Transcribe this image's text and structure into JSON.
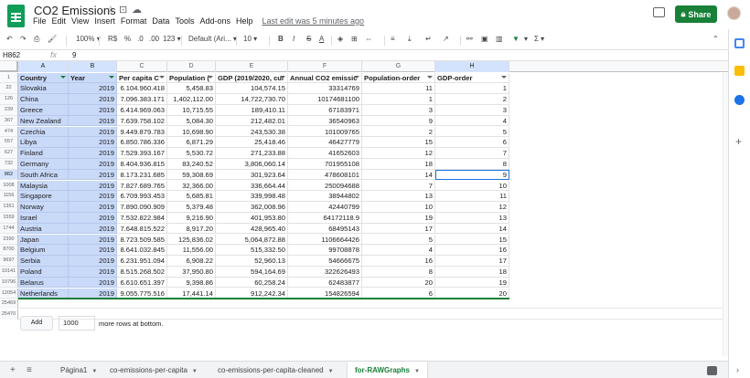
{
  "title_bar": {
    "doc_title": "CO2 Emissions",
    "menu": [
      "File",
      "Edit",
      "View",
      "Insert",
      "Format",
      "Data",
      "Tools",
      "Add-ons",
      "Help"
    ],
    "last_edit": "Last edit was 5 minutes ago",
    "share_label": "Share"
  },
  "toolbar": {
    "zoom": "100%",
    "currency": "R$",
    "percent": "%",
    "decimal_less": ".0",
    "decimal_more": ".00",
    "number_format": "123",
    "font": "Default (Ari...",
    "font_size": "10",
    "bold": "B",
    "italic": "I",
    "strike": "S",
    "text_color": "A",
    "sigma": "Σ"
  },
  "formula_bar": {
    "name_box": "H862",
    "fx": "fx",
    "value": "9"
  },
  "grid": {
    "columns": [
      "A",
      "B",
      "C",
      "D",
      "E",
      "F",
      "G",
      "H"
    ],
    "active_column": "H",
    "headers": [
      "Country",
      "Year",
      "Per capita C",
      "Population (",
      "GDP (2019/2020, cur",
      "Annual CO2 emissic",
      "Population-order",
      "GDP-order"
    ],
    "header_row_num": "1",
    "rows": [
      {
        "n": "22",
        "c": [
          "Slovakia",
          "2019",
          "6.104.960.418",
          "5,458.83",
          "104,574.15",
          "33314769",
          "11",
          "1"
        ]
      },
      {
        "n": "126",
        "c": [
          "China",
          "2019",
          "7.096.383.171",
          "1,402,112.00",
          "14,722,730.70",
          "10174681100",
          "1",
          "2"
        ]
      },
      {
        "n": "239",
        "c": [
          "Greece",
          "2019",
          "6.414.969.063",
          "10,715.55",
          "189,410.11",
          "67183971",
          "3",
          "3"
        ]
      },
      {
        "n": "367",
        "c": [
          "New Zealand",
          "2019",
          "7.639.758.102",
          "5,084.30",
          "212,482.01",
          "36540963",
          "9",
          "4"
        ]
      },
      {
        "n": "474",
        "c": [
          "Czechia",
          "2019",
          "9.449.879.783",
          "10,698.90",
          "243,530.38",
          "101009765",
          "2",
          "5"
        ]
      },
      {
        "n": "557",
        "c": [
          "Libya",
          "2019",
          "6.850.786.336",
          "6,871.29",
          "25,418.46",
          "46427779",
          "15",
          "6"
        ]
      },
      {
        "n": "627",
        "c": [
          "Finland",
          "2019",
          "7.529.393.167",
          "5,530.72",
          "271,233.88",
          "41652603",
          "12",
          "7"
        ]
      },
      {
        "n": "732",
        "c": [
          "Germany",
          "2019",
          "8.404.936.815",
          "83,240.52",
          "3,806,060.14",
          "701955108",
          "18",
          "8"
        ]
      },
      {
        "n": "862",
        "c": [
          "South Africa",
          "2019",
          "8.173.231.685",
          "59,308.69",
          "301,923.64",
          "478608101",
          "14",
          "9"
        ]
      },
      {
        "n": "1008",
        "c": [
          "Malaysia",
          "2019",
          "7.827.689.765",
          "32,366.00",
          "336,664.44",
          "250094688",
          "7",
          "10"
        ]
      },
      {
        "n": "1156",
        "c": [
          "Singapore",
          "2019",
          "6.709.993.453",
          "5,685.81",
          "339,998.48",
          "38944802",
          "13",
          "11"
        ]
      },
      {
        "n": "1351",
        "c": [
          "Norway",
          "2019",
          "7.890.090.909",
          "5,379.48",
          "362,008.96",
          "42440799",
          "10",
          "12"
        ]
      },
      {
        "n": "1559",
        "c": [
          "Israel",
          "2019",
          "7.532.822.984",
          "9,216.90",
          "401,953.80",
          "64172118.9",
          "19",
          "13"
        ]
      },
      {
        "n": "1744",
        "c": [
          "Austria",
          "2019",
          "7.648.815.522",
          "8,917.20",
          "428,965.40",
          "68495143",
          "17",
          "14"
        ]
      },
      {
        "n": "2390",
        "c": [
          "Japan",
          "2019",
          "8.723.509.585",
          "125,836.02",
          "5,064,872.88",
          "1106664426",
          "5",
          "15"
        ]
      },
      {
        "n": "8700",
        "c": [
          "Belgium",
          "2019",
          "8.641.032.845",
          "11,556.00",
          "515,332.50",
          "99708878",
          "4",
          "16"
        ]
      },
      {
        "n": "9697",
        "c": [
          "Serbia",
          "2019",
          "6.231.951.094",
          "6,908.22",
          "52,960.13",
          "54666675",
          "16",
          "17"
        ]
      },
      {
        "n": "10141",
        "c": [
          "Poland",
          "2019",
          "8.515.268.502",
          "37,950.80",
          "594,164.69",
          "322626493",
          "8",
          "18"
        ]
      },
      {
        "n": "10796",
        "c": [
          "Belarus",
          "2019",
          "6.610.651.397",
          "9,398.86",
          "60,258.24",
          "62483877",
          "20",
          "19"
        ]
      },
      {
        "n": "12054",
        "c": [
          "Netherlands",
          "2019",
          "9.055.775.516",
          "17,441.14",
          "912,242.34",
          "154826594",
          "6",
          "20"
        ]
      }
    ],
    "tail_rows": [
      "25469",
      "25470"
    ]
  },
  "add_rows": {
    "button": "Add",
    "count": "1000",
    "label": "more rows at bottom."
  },
  "sheet_tabs": {
    "add": "+",
    "all": "≡",
    "tabs": [
      "Página1",
      "co-emissions-per-capita",
      "co-emissions-per-capita-cleaned",
      "for-RAWGraphs"
    ],
    "active": "for-RAWGraphs"
  },
  "colors": {
    "brand_green": "#188038",
    "selection_blue": "#c9d9f8",
    "active_border": "#1a73e8"
  }
}
